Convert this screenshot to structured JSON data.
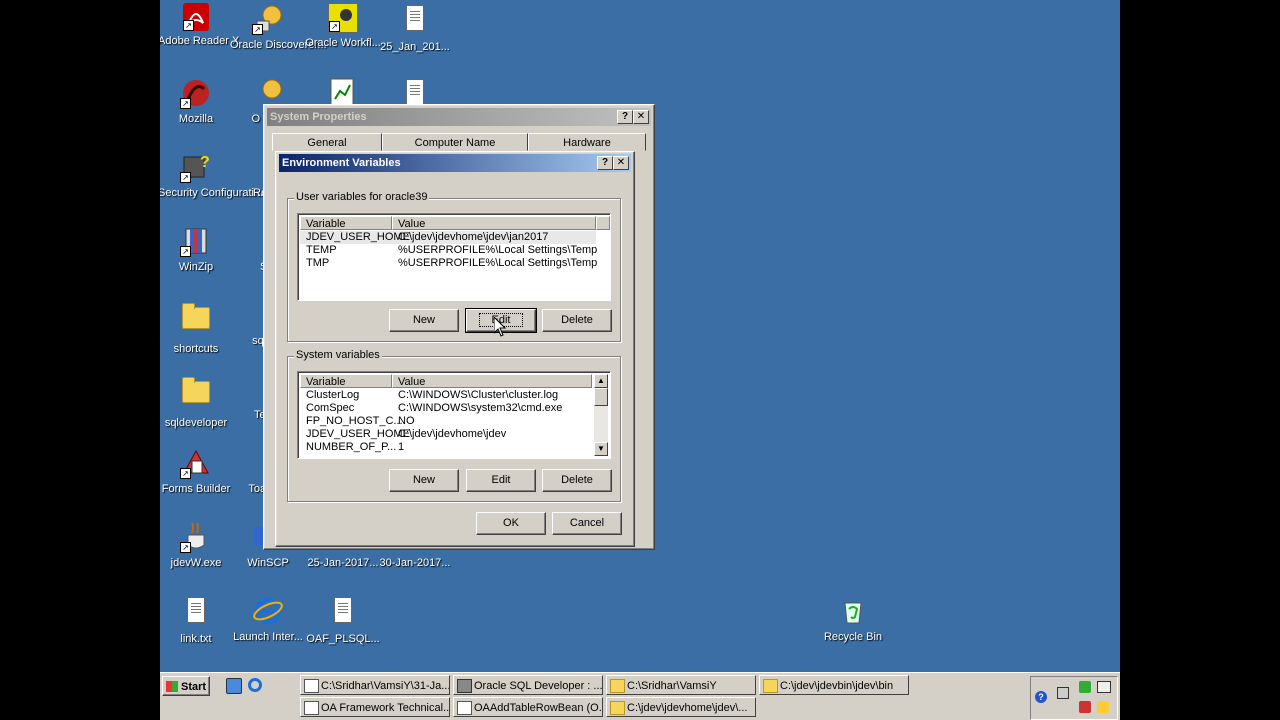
{
  "desktop": {
    "icons": [
      {
        "id": "adobe",
        "label": "Adobe Reader X"
      },
      {
        "id": "oracle-disc",
        "label": "Oracle Discoverer..."
      },
      {
        "id": "oracle-wf",
        "label": "Oracle Workfl..."
      },
      {
        "id": "jan25",
        "label": "25_Jan_201..."
      },
      {
        "id": "mozilla",
        "label": "Mozilla"
      },
      {
        "id": "oracle-disc2",
        "label": "O Disc"
      },
      {
        "id": "security",
        "label": "Security Configurati..."
      },
      {
        "id": "reports",
        "label": "Repor"
      },
      {
        "id": "winzip",
        "label": "WinZip"
      },
      {
        "id": "sq",
        "label": "SQ"
      },
      {
        "id": "shortcuts",
        "label": "shortcuts"
      },
      {
        "id": "sqldev-short",
        "label": "sqldev"
      },
      {
        "id": "sqldeveloper",
        "label": "sqldeveloper"
      },
      {
        "id": "term",
        "label": "Ter Vi"
      },
      {
        "id": "forms",
        "label": "Forms Builder"
      },
      {
        "id": "toad",
        "label": "Toa Ora"
      },
      {
        "id": "jdevw",
        "label": "jdevW.exe"
      },
      {
        "id": "winscp",
        "label": "WinSCP"
      },
      {
        "id": "jan25b",
        "label": "25-Jan-2017..."
      },
      {
        "id": "jan30",
        "label": "30-Jan-2017..."
      },
      {
        "id": "link",
        "label": "link.txt"
      },
      {
        "id": "launch",
        "label": "Launch Inter..."
      },
      {
        "id": "oaf",
        "label": "OAF_PLSQL..."
      },
      {
        "id": "recycle",
        "label": "Recycle Bin"
      }
    ]
  },
  "system_properties": {
    "title": "System Properties",
    "tabs": [
      "General",
      "Computer Name",
      "Hardware"
    ]
  },
  "env_vars": {
    "title": "Environment Variables",
    "user_group_label": "User variables for oracle39",
    "system_group_label": "System variables",
    "col_variable": "Variable",
    "col_value": "Value",
    "user_rows": [
      {
        "variable": "JDEV_USER_HOME",
        "value": "C:\\jdev\\jdevhome\\jdev\\jan2017"
      },
      {
        "variable": "TEMP",
        "value": "%USERPROFILE%\\Local Settings\\Temp"
      },
      {
        "variable": "TMP",
        "value": "%USERPROFILE%\\Local Settings\\Temp"
      }
    ],
    "system_rows": [
      {
        "variable": "ClusterLog",
        "value": "C:\\WINDOWS\\Cluster\\cluster.log"
      },
      {
        "variable": "ComSpec",
        "value": "C:\\WINDOWS\\system32\\cmd.exe"
      },
      {
        "variable": "FP_NO_HOST_C...",
        "value": "NO"
      },
      {
        "variable": "JDEV_USER_HOME",
        "value": "C:\\jdev\\jdevhome\\jdev"
      },
      {
        "variable": "NUMBER_OF_P...",
        "value": "1"
      }
    ],
    "user_buttons": {
      "new": "New",
      "edit": "Edit",
      "delete": "Delete"
    },
    "system_buttons": {
      "new": "New",
      "edit": "Edit",
      "delete": "Delete"
    },
    "ok": "OK",
    "cancel": "Cancel",
    "help_glyph": "?",
    "close_glyph": "✕"
  },
  "taskbar": {
    "start": "Start",
    "items_row1": [
      "C:\\Sridhar\\VamsiY\\31-Ja...",
      "Oracle SQL Developer : ...",
      "C:\\Sridhar\\VamsiY",
      "C:\\jdev\\jdevbin\\jdev\\bin"
    ],
    "items_row2": [
      "OA Framework Technical...",
      "OAAddTableRowBean (O...",
      "C:\\jdev\\jdevhome\\jdev\\..."
    ]
  },
  "colors": {
    "desktop": "#3a6ea5",
    "title_active": "#0a246a",
    "face": "#d4d0c8"
  }
}
